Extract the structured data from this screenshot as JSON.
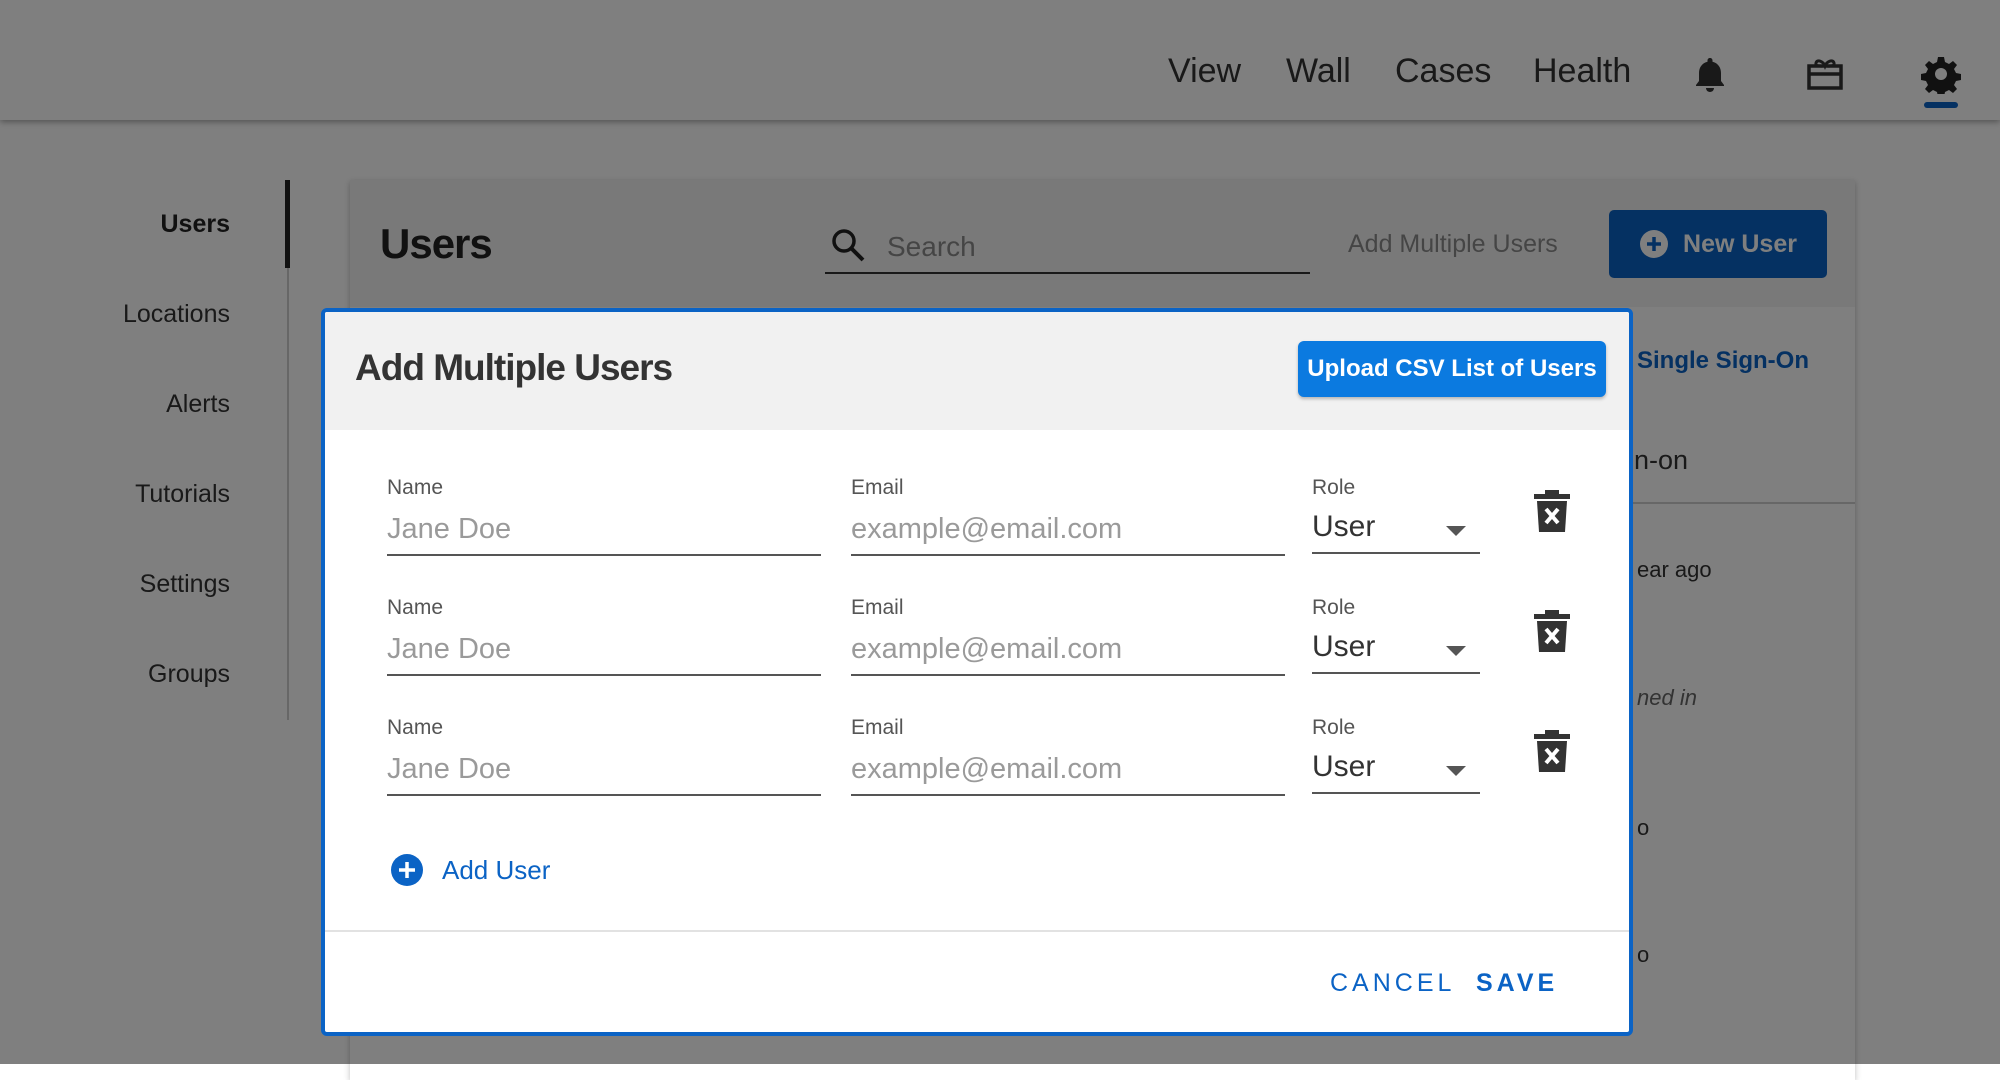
{
  "topbar": {
    "nav": [
      "View",
      "Wall",
      "Cases",
      "Health"
    ],
    "icons": [
      "bell-icon",
      "gift-card-icon",
      "gear-icon"
    ],
    "accent_color": "#0b63c5"
  },
  "sidebar": {
    "items": [
      {
        "label": "Users",
        "active": true
      },
      {
        "label": "Locations",
        "active": false
      },
      {
        "label": "Alerts",
        "active": false
      },
      {
        "label": "Tutorials",
        "active": false
      },
      {
        "label": "Settings",
        "active": false
      },
      {
        "label": "Groups",
        "active": false
      }
    ]
  },
  "users_page": {
    "title": "Users",
    "search_placeholder": "Search",
    "add_multiple_label": "Add Multiple Users",
    "new_user_label": "New User",
    "partial_texts": [
      "Single Sign-On",
      "n-on",
      "ear ago",
      "ned in",
      "o",
      "o"
    ]
  },
  "modal": {
    "title": "Add Multiple Users",
    "upload_label": "Upload CSV List of Users",
    "rows": [
      {
        "name_label": "Name",
        "name_placeholder": "Jane Doe",
        "email_label": "Email",
        "email_placeholder": "example@email.com",
        "role_label": "Role",
        "role_value": "User"
      },
      {
        "name_label": "Name",
        "name_placeholder": "Jane Doe",
        "email_label": "Email",
        "email_placeholder": "example@email.com",
        "role_label": "Role",
        "role_value": "User"
      },
      {
        "name_label": "Name",
        "name_placeholder": "Jane Doe",
        "email_label": "Email",
        "email_placeholder": "example@email.com",
        "role_label": "Role",
        "role_value": "User"
      }
    ],
    "add_user_label": "Add User",
    "cancel_label": "CANCEL",
    "save_label": "SAVE",
    "primary_color": "#0b63c5",
    "upload_color": "#0b7ae0"
  }
}
